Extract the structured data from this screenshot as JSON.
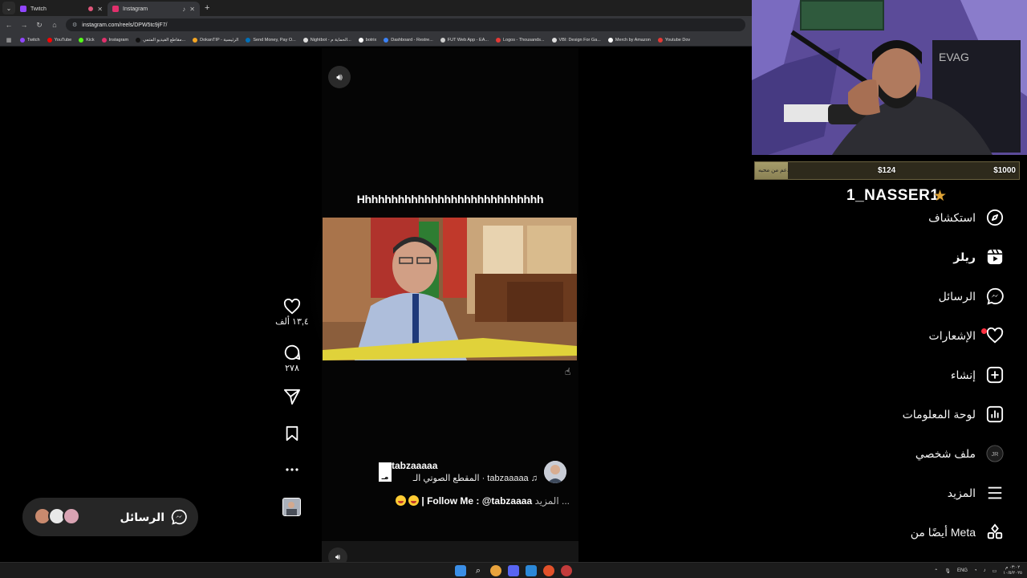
{
  "browser": {
    "tabs": [
      {
        "label": "Twitch",
        "color": "#9146ff",
        "active": false
      },
      {
        "label": "Instagram",
        "color": "#e1306c",
        "active": true
      }
    ],
    "url": "instagram.com/reels/DPW5tc9jF7/",
    "bookmarks": [
      {
        "label": "Twitch",
        "color": "#9146ff"
      },
      {
        "label": "YouTube",
        "color": "#ff0000"
      },
      {
        "label": "Kick",
        "color": "#53fc18"
      },
      {
        "label": "Instagram",
        "color": "#e1306c"
      },
      {
        "label": "مقاطع الفيديو المتمي...",
        "color": "#111111"
      },
      {
        "label": "DokanTIP - الرئيسية",
        "color": "#f5a623"
      },
      {
        "label": "Send Money, Pay O...",
        "color": "#0070ba"
      },
      {
        "label": "Nightbot - الحماية م...",
        "color": "#dddddd"
      },
      {
        "label": "botrix",
        "color": "#ffffff"
      },
      {
        "label": "Dashboard - Restre...",
        "color": "#3b82f6"
      },
      {
        "label": "FUT Web App - EA...",
        "color": "#cccccc"
      },
      {
        "label": "Logos - Thousands...",
        "color": "#e53935"
      },
      {
        "label": "VBI: Design For Ga...",
        "color": "#dddddd"
      },
      {
        "label": "Merch by Amazon",
        "color": "#ffffff"
      },
      {
        "label": "Youtube Dov",
        "color": "#e53935"
      }
    ]
  },
  "reel": {
    "caption_top": "Hhhhhhhhhhhhhhhhhhhhhhhhhhhh",
    "likes": "١٣,٤ ألف",
    "comments": "٢٧٨",
    "username": "tabzaaaaa",
    "audio": "tabzaaaaa · المقطع الصوتي الـ",
    "mini_label": "مـ",
    "caption_more": "المزيد ...",
    "caption_text": "| Follow Me : @tabzaaaa "
  },
  "messages_pill": {
    "label": "الرسائل"
  },
  "nav": [
    {
      "label": "استكشاف",
      "icon": "compass-icon",
      "bold": false
    },
    {
      "label": "ريلز",
      "icon": "reels-icon",
      "bold": true
    },
    {
      "label": "الرسائل",
      "icon": "messenger-icon",
      "bold": false
    },
    {
      "label": "الإشعارات",
      "icon": "heart-icon",
      "bold": false
    },
    {
      "label": "إنشاء",
      "icon": "plus-square-icon",
      "bold": false
    },
    {
      "label": "لوحة المعلومات",
      "icon": "dashboard-icon",
      "bold": false
    },
    {
      "label": "ملف شخصي",
      "icon": "profile-avatar-icon",
      "bold": false
    },
    {
      "label": "المزيد",
      "icon": "menu-icon",
      "bold": false
    },
    {
      "label": "أيضًا من Meta",
      "icon": "apps-grid-icon",
      "bold": false
    }
  ],
  "overlay": {
    "streamer": "1_NASSER1",
    "goal_note": "دعم من محبه",
    "goal_mid": "$124",
    "goal_max": "$1000",
    "goal_progress": 0.124,
    "cam_logo": "EVAG"
  },
  "taskbar": {
    "lang": "ENG",
    "time": "٠٣:٠٢ م",
    "date": "١٠/٥/٢٠٢٥"
  }
}
